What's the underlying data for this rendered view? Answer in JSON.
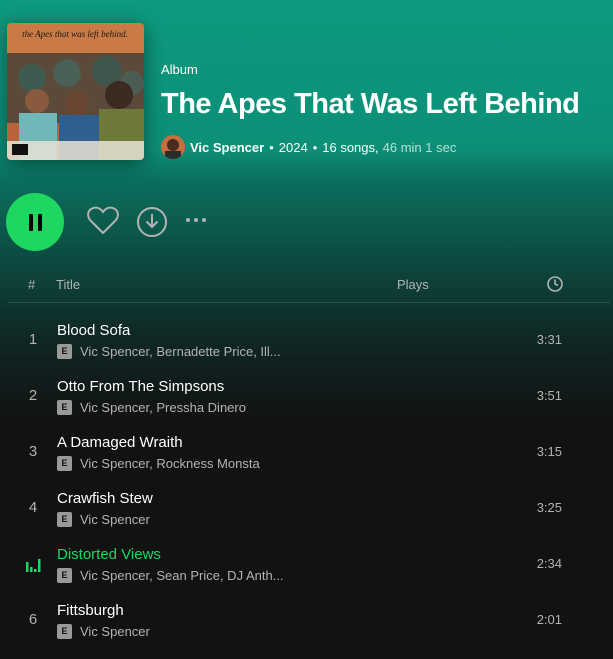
{
  "colors": {
    "accent": "#1ed760",
    "header_top": "#0d9a7e",
    "background": "#121212"
  },
  "album": {
    "type_label": "Album",
    "title": "The Apes That Was Left Behind",
    "cover_text": "the Apes that was left behind.",
    "artist": "Vic Spencer",
    "year": "2024",
    "song_count": "16 songs,",
    "duration": "46 min 1 sec",
    "separator": "•"
  },
  "controls": {
    "play_icon": "pause-icon",
    "like_icon": "heart-icon",
    "download_icon": "download-icon",
    "more_icon": "more-icon"
  },
  "table": {
    "headers": {
      "num": "#",
      "title": "Title",
      "plays": "Plays",
      "duration_icon": "clock-icon"
    },
    "explicit_label": "E",
    "tracks": [
      {
        "num": "1",
        "title": "Blood Sofa",
        "artists": "Vic Spencer, Bernadette Price, Ill...",
        "duration": "3:31",
        "playing": false
      },
      {
        "num": "2",
        "title": "Otto From The Simpsons",
        "artists": "Vic Spencer, Pressha Dinero",
        "duration": "3:51",
        "playing": false
      },
      {
        "num": "3",
        "title": "A Damaged Wraith",
        "artists": "Vic Spencer, Rockness Monsta",
        "duration": "3:15",
        "playing": false
      },
      {
        "num": "4",
        "title": "Crawfish Stew",
        "artists": "Vic Spencer",
        "duration": "3:25",
        "playing": false
      },
      {
        "num": "",
        "title": "Distorted Views",
        "artists": "Vic Spencer, Sean Price, DJ Anth...",
        "duration": "2:34",
        "playing": true
      },
      {
        "num": "6",
        "title": "Fittsburgh",
        "artists": "Vic Spencer",
        "duration": "2:01",
        "playing": false
      }
    ]
  }
}
